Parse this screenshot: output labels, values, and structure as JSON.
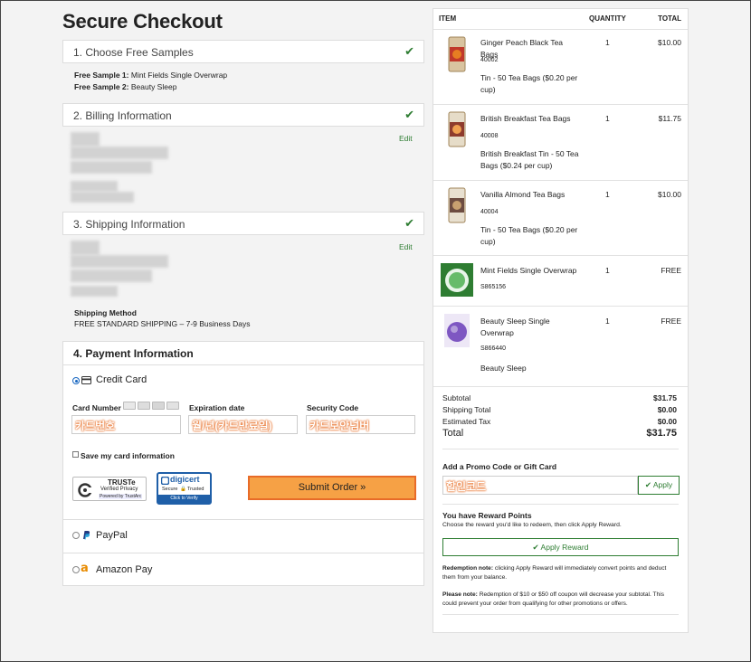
{
  "page_title": "Secure Checkout",
  "steps": [
    {
      "label": "1. Choose Free Samples"
    },
    {
      "label": "2. Billing Information",
      "edit": "Edit"
    },
    {
      "label": "3. Shipping Information",
      "edit": "Edit"
    }
  ],
  "samples": {
    "s1_label": "Free Sample 1:",
    "s1_value": "Mint Fields Single Overwrap",
    "s2_label": "Free Sample 2:",
    "s2_value": "Beauty Sleep"
  },
  "shipping_method": {
    "label": "Shipping Method",
    "value": "FREE STANDARD SHIPPING – 7-9 Business Days"
  },
  "payment": {
    "heading": "4. Payment Information",
    "credit_card_label": "Credit Card",
    "card_number_label": "Card Number",
    "card_number_value": "카드번호",
    "expiration_label": "Expiration date",
    "expiration_value": "월/년(카드만료일)",
    "security_label": "Security Code",
    "security_value": "카드보안넘버",
    "save_card_label": "Save my card information",
    "submit_label": "Submit Order »",
    "paypal_label": "PayPal",
    "amazon_label": "Amazon Pay"
  },
  "badges": {
    "truste_title": "TRUSTe",
    "truste_sub": "Verified Privacy",
    "truste_powered": "Powered by TrustArc",
    "digicert_title": "digicert",
    "digicert_sub": "Secure",
    "digicert_trusted": "Trusted",
    "digicert_verify": "Click to Verify"
  },
  "order": {
    "headers": {
      "item": "ITEM",
      "quantity": "QUANTITY",
      "total": "TOTAL"
    },
    "items": [
      {
        "name": "Ginger Peach Black Tea Bags",
        "sku": "40002",
        "desc": "Tin - 50 Tea Bags ($0.20 per cup)",
        "qty": "1",
        "total": "$10.00"
      },
      {
        "name": "British Breakfast Tea Bags",
        "sku": "40008",
        "desc": "British Breakfast Tin - 50 Tea Bags ($0.24 per cup)",
        "qty": "1",
        "total": "$11.75"
      },
      {
        "name": "Vanilla Almond Tea Bags",
        "sku": "40004",
        "desc": "Tin - 50 Tea Bags ($0.20 per cup)",
        "qty": "1",
        "total": "$10.00"
      },
      {
        "name": "Mint Fields Single Overwrap",
        "sku": "S865156",
        "desc": "",
        "qty": "1",
        "total": "FREE"
      },
      {
        "name": "Beauty Sleep Single Overwrap",
        "sku": "S866440",
        "desc": "Beauty Sleep",
        "qty": "1",
        "total": "FREE"
      }
    ],
    "summary": {
      "subtotal_label": "Subtotal",
      "subtotal": "$31.75",
      "shipping_label": "Shipping Total",
      "shipping": "$0.00",
      "tax_label": "Estimated Tax",
      "tax": "$0.00",
      "total_label": "Total",
      "total": "$31.75"
    },
    "promo": {
      "label": "Add a Promo Code or Gift Card",
      "value": "할인코드",
      "apply": "Apply"
    },
    "rewards": {
      "title": "You have Reward Points",
      "subtitle": "Choose the reward you'd like to redeem, then click Apply Reward.",
      "apply": "Apply Reward",
      "note1_bold": "Redemption note:",
      "note1": "clicking Apply Reward will immediately convert points and deduct them from your balance.",
      "note2_bold": "Please note:",
      "note2": "Redemption of $10 or $50 off coupon will decrease your subtotal. This could prevent your order from qualifying for other promotions or offers."
    }
  },
  "colors": {
    "accent_green": "#2e7d32",
    "submit_orange": "#f6a145",
    "submit_border": "#e86b28",
    "radio_blue": "#1565c0"
  }
}
